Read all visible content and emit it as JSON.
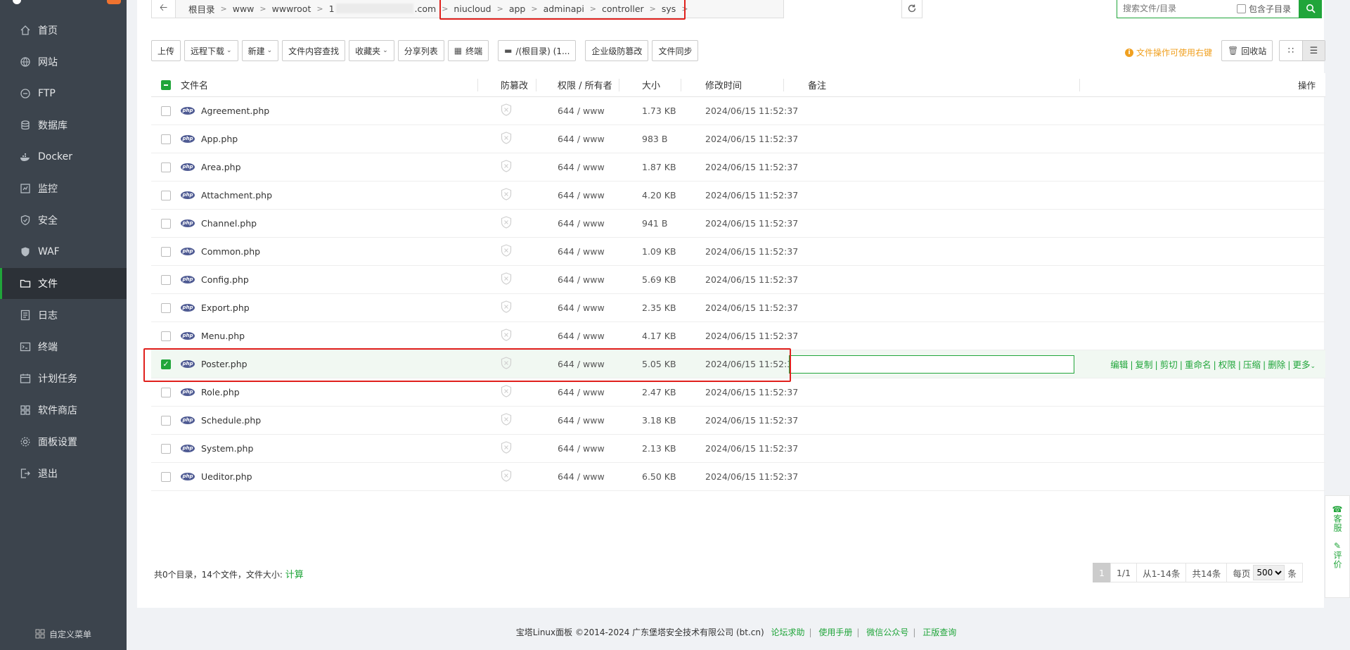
{
  "sidebar": {
    "items": [
      {
        "label": "首页",
        "icon": "home-icon"
      },
      {
        "label": "网站",
        "icon": "globe-icon"
      },
      {
        "label": "FTP",
        "icon": "ftp-icon"
      },
      {
        "label": "数据库",
        "icon": "database-icon"
      },
      {
        "label": "Docker",
        "icon": "docker-icon"
      },
      {
        "label": "监控",
        "icon": "monitor-icon"
      },
      {
        "label": "安全",
        "icon": "shield-icon"
      },
      {
        "label": "WAF",
        "icon": "waf-icon"
      },
      {
        "label": "文件",
        "icon": "folder-icon"
      },
      {
        "label": "日志",
        "icon": "log-icon"
      },
      {
        "label": "终端",
        "icon": "terminal-icon"
      },
      {
        "label": "计划任务",
        "icon": "calendar-icon"
      },
      {
        "label": "软件商店",
        "icon": "grid-icon"
      },
      {
        "label": "面板设置",
        "icon": "gear-icon"
      },
      {
        "label": "退出",
        "icon": "logout-icon"
      }
    ],
    "active_label": "文件",
    "custom_menu": "自定义菜单"
  },
  "path": {
    "crumbs": [
      "根目录",
      "www",
      "wwwroot",
      "1",
      ".com",
      "niucloud",
      "app",
      "adminapi",
      "controller",
      "sys"
    ]
  },
  "search": {
    "placeholder": "搜索文件/目录",
    "include_subdir": "包含子目录"
  },
  "toolbar": {
    "upload": "上传",
    "remote_download": "远程下载",
    "new": "新建",
    "content_search": "文件内容查找",
    "favorites": "收藏夹",
    "share_list": "分享列表",
    "terminal": "终端",
    "disk": "/(根目录) (1...",
    "tamper": "企业级防篡改",
    "sync": "文件同步",
    "hint": "文件操作可使用右键",
    "recycle": "回收站"
  },
  "table": {
    "headers": {
      "name": "文件名",
      "tamper": "防篡改",
      "perm": "权限 / 所有者",
      "size": "大小",
      "time": "修改时间",
      "note": "备注",
      "ops": "操作"
    },
    "rows": [
      {
        "name": "Agreement.php",
        "perm": "644 / www",
        "size": "1.73 KB",
        "time": "2024/06/15 11:52:37"
      },
      {
        "name": "App.php",
        "perm": "644 / www",
        "size": "983 B",
        "time": "2024/06/15 11:52:37"
      },
      {
        "name": "Area.php",
        "perm": "644 / www",
        "size": "1.87 KB",
        "time": "2024/06/15 11:52:37"
      },
      {
        "name": "Attachment.php",
        "perm": "644 / www",
        "size": "4.20 KB",
        "time": "2024/06/15 11:52:37"
      },
      {
        "name": "Channel.php",
        "perm": "644 / www",
        "size": "941 B",
        "time": "2024/06/15 11:52:37"
      },
      {
        "name": "Common.php",
        "perm": "644 / www",
        "size": "1.09 KB",
        "time": "2024/06/15 11:52:37"
      },
      {
        "name": "Config.php",
        "perm": "644 / www",
        "size": "5.69 KB",
        "time": "2024/06/15 11:52:37"
      },
      {
        "name": "Export.php",
        "perm": "644 / www",
        "size": "2.35 KB",
        "time": "2024/06/15 11:52:37"
      },
      {
        "name": "Menu.php",
        "perm": "644 / www",
        "size": "4.17 KB",
        "time": "2024/06/15 11:52:37"
      },
      {
        "name": "Poster.php",
        "perm": "644 / www",
        "size": "5.05 KB",
        "time": "2024/06/15 11:52:37"
      },
      {
        "name": "Role.php",
        "perm": "644 / www",
        "size": "2.47 KB",
        "time": "2024/06/15 11:52:37"
      },
      {
        "name": "Schedule.php",
        "perm": "644 / www",
        "size": "3.18 KB",
        "time": "2024/06/15 11:52:37"
      },
      {
        "name": "System.php",
        "perm": "644 / www",
        "size": "2.13 KB",
        "time": "2024/06/15 11:52:37"
      },
      {
        "name": "Ueditor.php",
        "perm": "644 / www",
        "size": "6.50 KB",
        "time": "2024/06/15 11:52:37"
      }
    ],
    "selected_row": "Poster.php",
    "ops": [
      "编辑",
      "复制",
      "剪切",
      "重命名",
      "权限",
      "压缩",
      "删除",
      "更多"
    ]
  },
  "summary": {
    "text": "共0个目录，14个文件，文件大小:",
    "calc": "计算"
  },
  "pager": {
    "current": "1",
    "pages": "1/1",
    "range": "从1-14条",
    "total": "共14条",
    "per_page_label": "每页",
    "per_page": "500",
    "unit": "条"
  },
  "footer": {
    "copyright": "宝塔Linux面板 ©2014-2024 广东堡塔安全技术有限公司 (bt.cn)",
    "links": [
      "论坛求助",
      "使用手册",
      "微信公众号",
      "正版查询"
    ]
  },
  "floater": {
    "service": "客服",
    "review": "评价"
  },
  "colors": {
    "accent": "#20a53a",
    "sidebar_bg": "#3c444d",
    "highlight_box": "#e0201c",
    "hint": "#f0a020"
  }
}
